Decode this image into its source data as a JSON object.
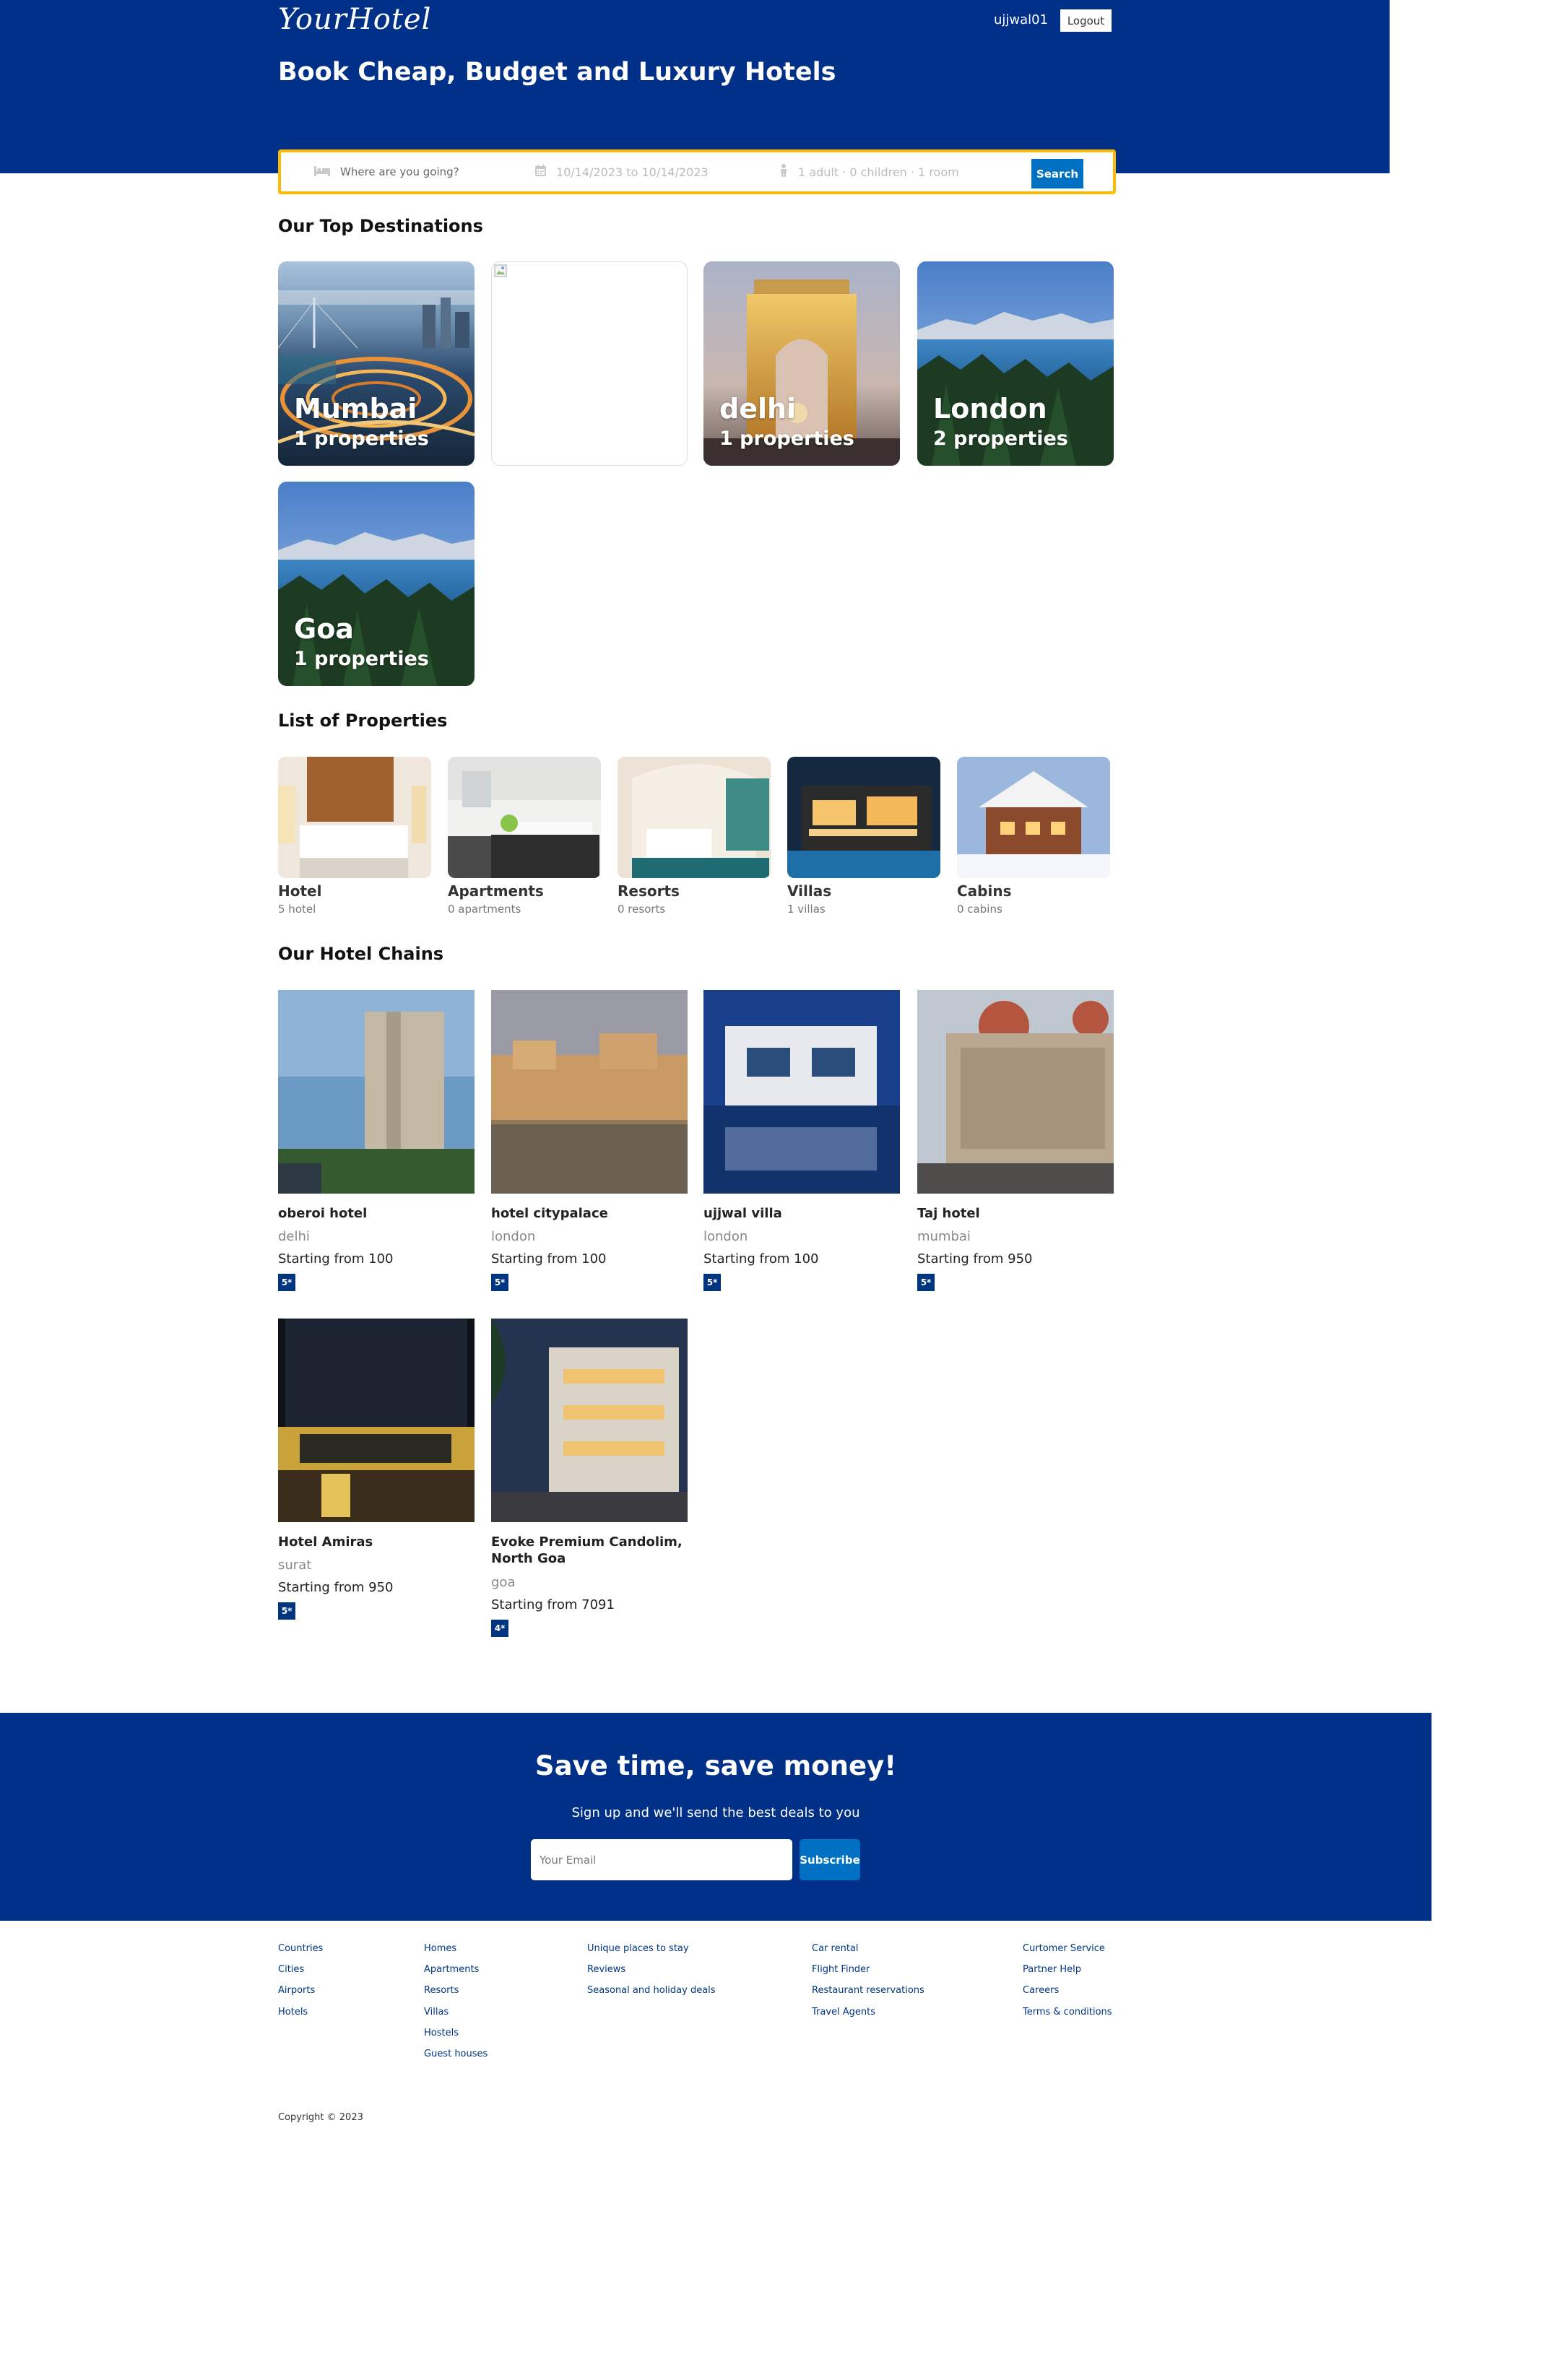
{
  "brand": {
    "logo": "YourHotel",
    "user": "ujjwal01",
    "logout_label": "Logout"
  },
  "hero": {
    "title": "Book Cheap, Budget and Luxury Hotels"
  },
  "search": {
    "destination_placeholder": "Where are you going?",
    "dates": "10/14/2023 to 10/14/2023",
    "options": "1 adult · 0 children · 1 room",
    "button": "Search"
  },
  "sections": {
    "top_destinations": "Our Top Destinations",
    "property_list": "List of Properties",
    "hotel_chains": "Our Hotel Chains"
  },
  "destinations": [
    {
      "name": "Mumbai",
      "count": "1 properties"
    },
    {
      "name": "",
      "count": ""
    },
    {
      "name": "delhi",
      "count": "1 properties"
    },
    {
      "name": "London",
      "count": "2 properties"
    },
    {
      "name": "Goa",
      "count": "1 properties"
    }
  ],
  "property_types": [
    {
      "name": "Hotel",
      "count": "5 hotel"
    },
    {
      "name": "Apartments",
      "count": "0 apartments"
    },
    {
      "name": "Resorts",
      "count": "0 resorts"
    },
    {
      "name": "Villas",
      "count": "1 villas"
    },
    {
      "name": "Cabins",
      "count": "0 cabins"
    }
  ],
  "hotels": [
    {
      "name": "oberoi hotel",
      "city": "delhi",
      "price": "Starting from 100",
      "rating": "5*"
    },
    {
      "name": "hotel citypalace",
      "city": "london",
      "price": "Starting from 100",
      "rating": "5*"
    },
    {
      "name": "ujjwal villa",
      "city": "london",
      "price": "Starting from 100",
      "rating": "5*"
    },
    {
      "name": "Taj hotel",
      "city": "mumbai",
      "price": "Starting from 950",
      "rating": "5*"
    },
    {
      "name": "Hotel Amiras",
      "city": "surat",
      "price": "Starting from 950",
      "rating": "5*"
    },
    {
      "name": "Evoke Premium Candolim, North Goa",
      "city": "goa",
      "price": "Starting from 7091",
      "rating": "4*"
    }
  ],
  "mail": {
    "title": "Save time, save money!",
    "subtitle": "Sign up and we'll send the best deals to you",
    "placeholder": "Your Email",
    "button": "Subscribe"
  },
  "footer": {
    "col1": [
      "Countries",
      "Cities",
      "Airports",
      "Hotels"
    ],
    "col2": [
      "Homes",
      "Apartments",
      "Resorts",
      "Villas",
      "Hostels",
      "Guest houses"
    ],
    "col3": [
      "Unique places to stay",
      "Reviews",
      "Seasonal and holiday deals"
    ],
    "col4": [
      "Car rental",
      "Flight Finder",
      "Restaurant reservations",
      "Travel Agents"
    ],
    "col5": [
      "Curtomer Service",
      "Partner Help",
      "Careers",
      "Terms & conditions"
    ],
    "copyright": "Copyright © 2023"
  },
  "colors": {
    "brand_blue": "#003087",
    "accent_blue": "#0071c2",
    "search_border": "#febb02",
    "link": "#003580"
  }
}
